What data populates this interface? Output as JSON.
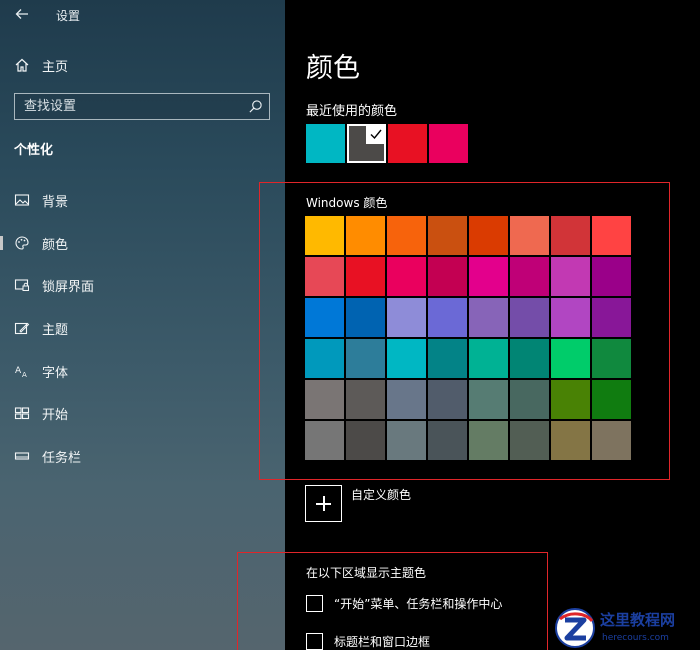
{
  "app": {
    "title": "设置"
  },
  "sidebar": {
    "home_label": "主页",
    "search_placeholder": "查找设置",
    "section_heading": "个性化",
    "items": [
      {
        "label": "背景",
        "icon": "image-icon"
      },
      {
        "label": "颜色",
        "icon": "palette-icon",
        "selected": true
      },
      {
        "label": "锁屏界面",
        "icon": "lock-screen-icon"
      },
      {
        "label": "主题",
        "icon": "theme-icon"
      },
      {
        "label": "字体",
        "icon": "font-icon"
      },
      {
        "label": "开始",
        "icon": "start-icon"
      },
      {
        "label": "任务栏",
        "icon": "taskbar-icon"
      }
    ]
  },
  "main": {
    "title": "颜色",
    "recent_label": "最近使用的颜色",
    "recent_colors": [
      "#00b7c3",
      "#4c4a48",
      "#e81123",
      "#ea005e"
    ],
    "recent_selected_index": 1,
    "windows_label": "Windows 颜色",
    "palette": [
      "#ffb900",
      "#ff8c00",
      "#f7630c",
      "#ca5010",
      "#da3b01",
      "#ef6950",
      "#d13438",
      "#ff4343",
      "#e74856",
      "#e81123",
      "#ea005e",
      "#c30052",
      "#e3008c",
      "#bf0077",
      "#c239b3",
      "#9a0089",
      "#0078d7",
      "#0063b1",
      "#8e8cd8",
      "#6b69d6",
      "#8764b8",
      "#744da9",
      "#b146c2",
      "#881798",
      "#0099bc",
      "#2d7d9a",
      "#00b7c3",
      "#038387",
      "#00b294",
      "#018574",
      "#00cc6a",
      "#10893e",
      "#7a7574",
      "#5d5a58",
      "#68768a",
      "#515c6b",
      "#567c73",
      "#486860",
      "#498205",
      "#107c10",
      "#767676",
      "#4c4a48",
      "#69797e",
      "#4a5459",
      "#647c64",
      "#525e54",
      "#847545",
      "#7e735f"
    ],
    "custom_label": "自定义颜色",
    "show_label": "在以下区域显示主题色",
    "checkboxes": [
      {
        "label": "“开始”菜单、任务栏和操作中心",
        "checked": false
      },
      {
        "label": "标题栏和窗口边框",
        "checked": false
      }
    ]
  },
  "watermark": {
    "name": "这里教程网",
    "url": "herecours.com"
  }
}
